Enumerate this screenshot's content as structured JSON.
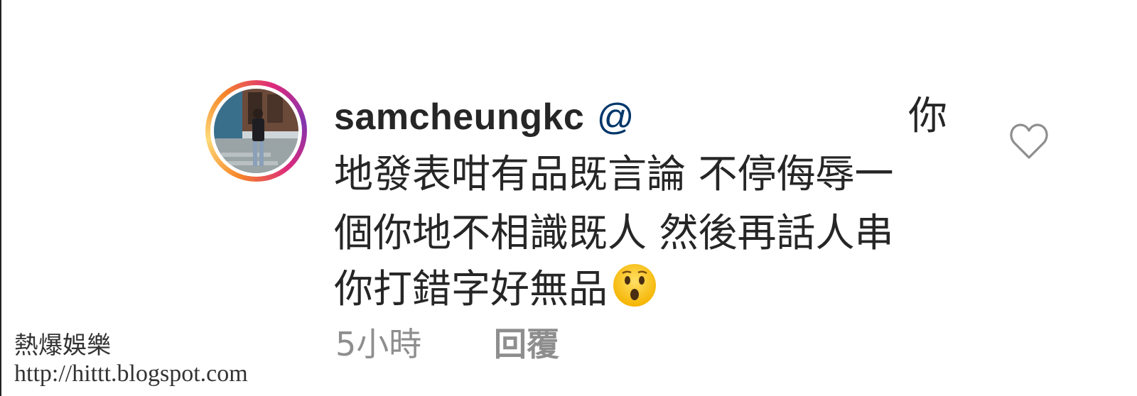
{
  "comment": {
    "username": "samcheungkc",
    "mention": "@",
    "lines": [
      "你",
      "地發表咁有品既言論 不停侮辱一",
      "個你地不相識既人 然後再話人串",
      "你打錯字好無品"
    ],
    "emoji": "hushed-face-emoji",
    "time": "5小時",
    "reply_label": "回覆",
    "like_icon": "heart-outline-icon",
    "avatar_ring_colors": [
      "#f58529",
      "#dd2a7b",
      "#8134af"
    ]
  },
  "watermark": {
    "title": "熱爆娛樂",
    "url": "http://hittt.blogspot.com"
  }
}
